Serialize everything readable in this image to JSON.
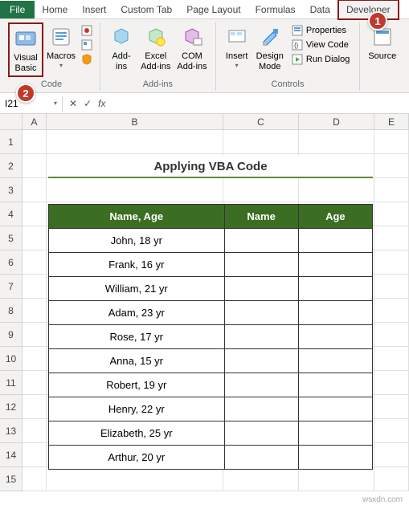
{
  "tabs": {
    "file": "File",
    "home": "Home",
    "insert": "Insert",
    "custom": "Custom Tab",
    "pagelayout": "Page Layout",
    "formulas": "Formulas",
    "data": "Data",
    "developer": "Developer"
  },
  "ribbon": {
    "code": {
      "visual_basic": "Visual\nBasic",
      "macros": "Macros",
      "label": "Code"
    },
    "addins": {
      "addins": "Add-\nins",
      "excel_addins": "Excel\nAdd-ins",
      "com_addins": "COM\nAdd-ins",
      "label": "Add-ins"
    },
    "controls": {
      "insert": "Insert",
      "design_mode": "Design\nMode",
      "properties": "Properties",
      "view_code": "View Code",
      "run_dialog": "Run Dialog",
      "label": "Controls"
    },
    "xml": {
      "source": "Source"
    }
  },
  "callouts": {
    "one": "1",
    "two": "2"
  },
  "formula_bar": {
    "name_box": "I21",
    "fx": "fx"
  },
  "columns": [
    "A",
    "B",
    "C",
    "D",
    "E"
  ],
  "rows": [
    "1",
    "2",
    "3",
    "4",
    "5",
    "6",
    "7",
    "8",
    "9",
    "10",
    "11",
    "12",
    "13",
    "14",
    "15"
  ],
  "sheet": {
    "title": "Applying VBA Code",
    "headers": {
      "name_age": "Name, Age",
      "name": "Name",
      "age": "Age"
    },
    "data": [
      {
        "name_age": "John, 18 yr",
        "name": "",
        "age": ""
      },
      {
        "name_age": "Frank, 16 yr",
        "name": "",
        "age": ""
      },
      {
        "name_age": "William, 21 yr",
        "name": "",
        "age": ""
      },
      {
        "name_age": "Adam, 23 yr",
        "name": "",
        "age": ""
      },
      {
        "name_age": "Rose, 17 yr",
        "name": "",
        "age": ""
      },
      {
        "name_age": "Anna, 15 yr",
        "name": "",
        "age": ""
      },
      {
        "name_age": "Robert, 19 yr",
        "name": "",
        "age": ""
      },
      {
        "name_age": "Henry, 22 yr",
        "name": "",
        "age": ""
      },
      {
        "name_age": "Elizabeth, 25 yr",
        "name": "",
        "age": ""
      },
      {
        "name_age": "Arthur, 20 yr",
        "name": "",
        "age": ""
      }
    ]
  },
  "watermark": "wsxdn.com"
}
